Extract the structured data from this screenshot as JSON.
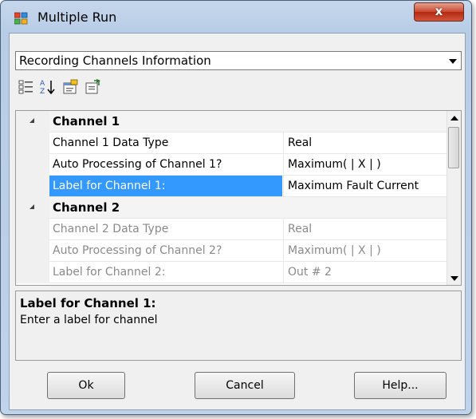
{
  "window": {
    "title": "Multiple Run",
    "close_label": "x"
  },
  "dropdown": {
    "selected": "Recording Channels Information"
  },
  "toolbar": {
    "icons": [
      "categorized-icon",
      "alphabetical-sort-icon",
      "property-pages-icon",
      "events-icon"
    ]
  },
  "grid": {
    "categories": [
      {
        "label": "Channel 1",
        "rows": [
          {
            "name": "Channel 1 Data Type",
            "value": "Real"
          },
          {
            "name": "Auto Processing of Channel 1?",
            "value": "Maximum( | X | )"
          },
          {
            "name": "Label for Channel 1:",
            "value": "Maximum Fault Current"
          }
        ]
      },
      {
        "label": "Channel 2",
        "rows": [
          {
            "name": "Channel 2 Data Type",
            "value": "Real"
          },
          {
            "name": "Auto Processing of Channel 2?",
            "value": "Maximum( | X | )"
          },
          {
            "name": "Label for Channel 2:",
            "value": "Out # 2"
          }
        ]
      }
    ]
  },
  "help": {
    "title": "Label for Channel 1:",
    "description": "Enter a label for channel"
  },
  "buttons": {
    "ok": "Ok",
    "cancel": "Cancel",
    "help": "Help..."
  },
  "colors": {
    "selection": "#3399ff",
    "close_button": "#c9462e",
    "disabled_text": "#8a8a8a"
  }
}
